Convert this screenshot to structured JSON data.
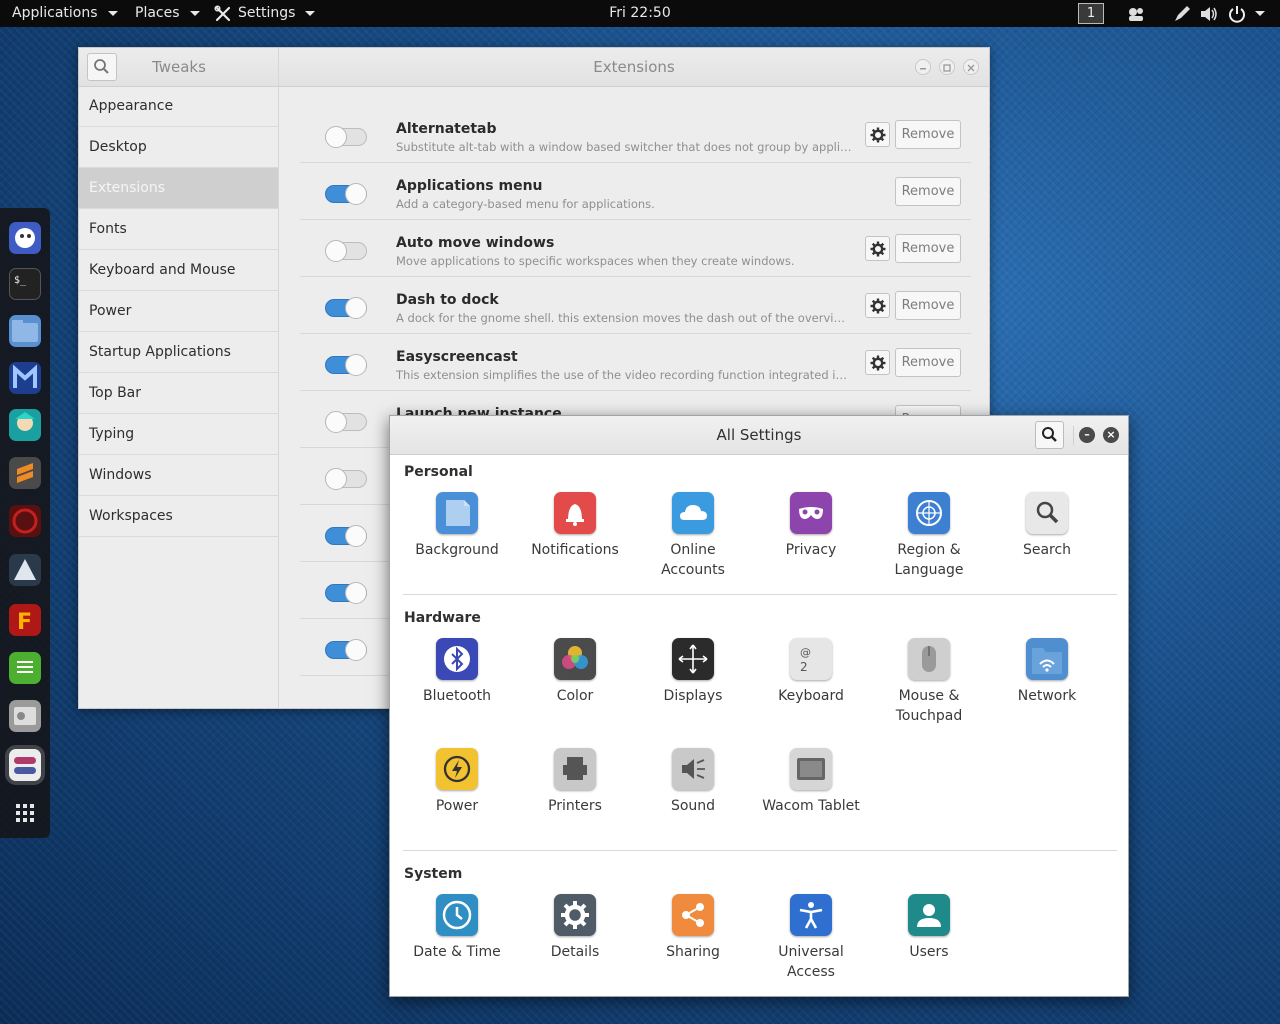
{
  "topbar": {
    "applications": "Applications",
    "places": "Places",
    "settings": "Settings",
    "clock": "Fri 22:50",
    "workspace": "1"
  },
  "dash": {
    "items": [
      "system-monitor-icon",
      "terminal-icon",
      "files-icon",
      "malwarebytes-icon",
      "game-icon",
      "sublime-icon",
      "crash-icon",
      "inkscape-icon",
      "filezilla-icon",
      "text-editor-icon",
      "disk-utility-icon",
      "tweaks-icon",
      "app-grid-icon"
    ]
  },
  "tweaks": {
    "title": "Tweaks",
    "panel_title": "Extensions",
    "sidebar": [
      "Appearance",
      "Desktop",
      "Extensions",
      "Fonts",
      "Keyboard and Mouse",
      "Power",
      "Startup Applications",
      "Top Bar",
      "Typing",
      "Windows",
      "Workspaces"
    ],
    "selected": "Extensions",
    "remove_label": "Remove",
    "extensions": [
      {
        "name": "Alternatetab",
        "desc": "Substitute alt-tab with a window based switcher that does not group by application.",
        "enabled": false,
        "settings": true
      },
      {
        "name": "Applications menu",
        "desc": "Add a category-based menu for applications.",
        "enabled": true,
        "settings": false
      },
      {
        "name": "Auto move windows",
        "desc": "Move applications to specific workspaces when they create windows.",
        "enabled": false,
        "settings": true
      },
      {
        "name": "Dash to dock",
        "desc": "A dock for the gnome shell. this extension moves the dash out of the overview tran...",
        "enabled": true,
        "settings": true
      },
      {
        "name": "Easyscreencast",
        "desc": "This extension simplifies the use of the video recording function integrated in gno...",
        "enabled": true,
        "settings": true
      },
      {
        "name": "Launch new instance",
        "desc": "",
        "enabled": false,
        "settings": false
      }
    ],
    "hidden_toggles": [
      false,
      true,
      true,
      true
    ]
  },
  "settings": {
    "title": "All Settings",
    "sections": [
      {
        "title": "Personal",
        "items": [
          {
            "label": "Background",
            "icon": "background-icon",
            "color": "#4a90d9"
          },
          {
            "label": "Notifications",
            "icon": "notifications-icon",
            "color": "#e34a4a"
          },
          {
            "label": "Online Accounts",
            "icon": "online-accounts-icon",
            "color": "#3a9be0"
          },
          {
            "label": "Privacy",
            "icon": "privacy-icon",
            "color": "#8e44ad"
          },
          {
            "label": "Region & Language",
            "icon": "region-language-icon",
            "color": "#3d7fd0"
          },
          {
            "label": "Search",
            "icon": "search-icon",
            "color": "#e8e8e8"
          }
        ]
      },
      {
        "title": "Hardware",
        "items": [
          {
            "label": "Bluetooth",
            "icon": "bluetooth-icon",
            "color": "#3a49b5"
          },
          {
            "label": "Color",
            "icon": "color-icon",
            "color": "#4b4b4b"
          },
          {
            "label": "Displays",
            "icon": "displays-icon",
            "color": "#2b2b2b"
          },
          {
            "label": "Keyboard",
            "icon": "keyboard-icon",
            "color": "#e6e6e6"
          },
          {
            "label": "Mouse & Touchpad",
            "icon": "mouse-icon",
            "color": "#cfcfcf"
          },
          {
            "label": "Network",
            "icon": "network-icon",
            "color": "#4f8fd0"
          },
          {
            "label": "Power",
            "icon": "power-icon",
            "color": "#f3c230"
          },
          {
            "label": "Printers",
            "icon": "printers-icon",
            "color": "#c8c8c8"
          },
          {
            "label": "Sound",
            "icon": "sound-icon",
            "color": "#c9c9c9"
          },
          {
            "label": "Wacom Tablet",
            "icon": "wacom-tablet-icon",
            "color": "#d6d6d6"
          }
        ]
      },
      {
        "title": "System",
        "items": [
          {
            "label": "Date & Time",
            "icon": "date-time-icon",
            "color": "#2f8fc4"
          },
          {
            "label": "Details",
            "icon": "details-icon",
            "color": "#4f5b66"
          },
          {
            "label": "Sharing",
            "icon": "sharing-icon",
            "color": "#f08a3c"
          },
          {
            "label": "Universal Access",
            "icon": "universal-access-icon",
            "color": "#2f6fd0"
          },
          {
            "label": "Users",
            "icon": "users-icon",
            "color": "#1f8a8a"
          }
        ]
      }
    ]
  }
}
